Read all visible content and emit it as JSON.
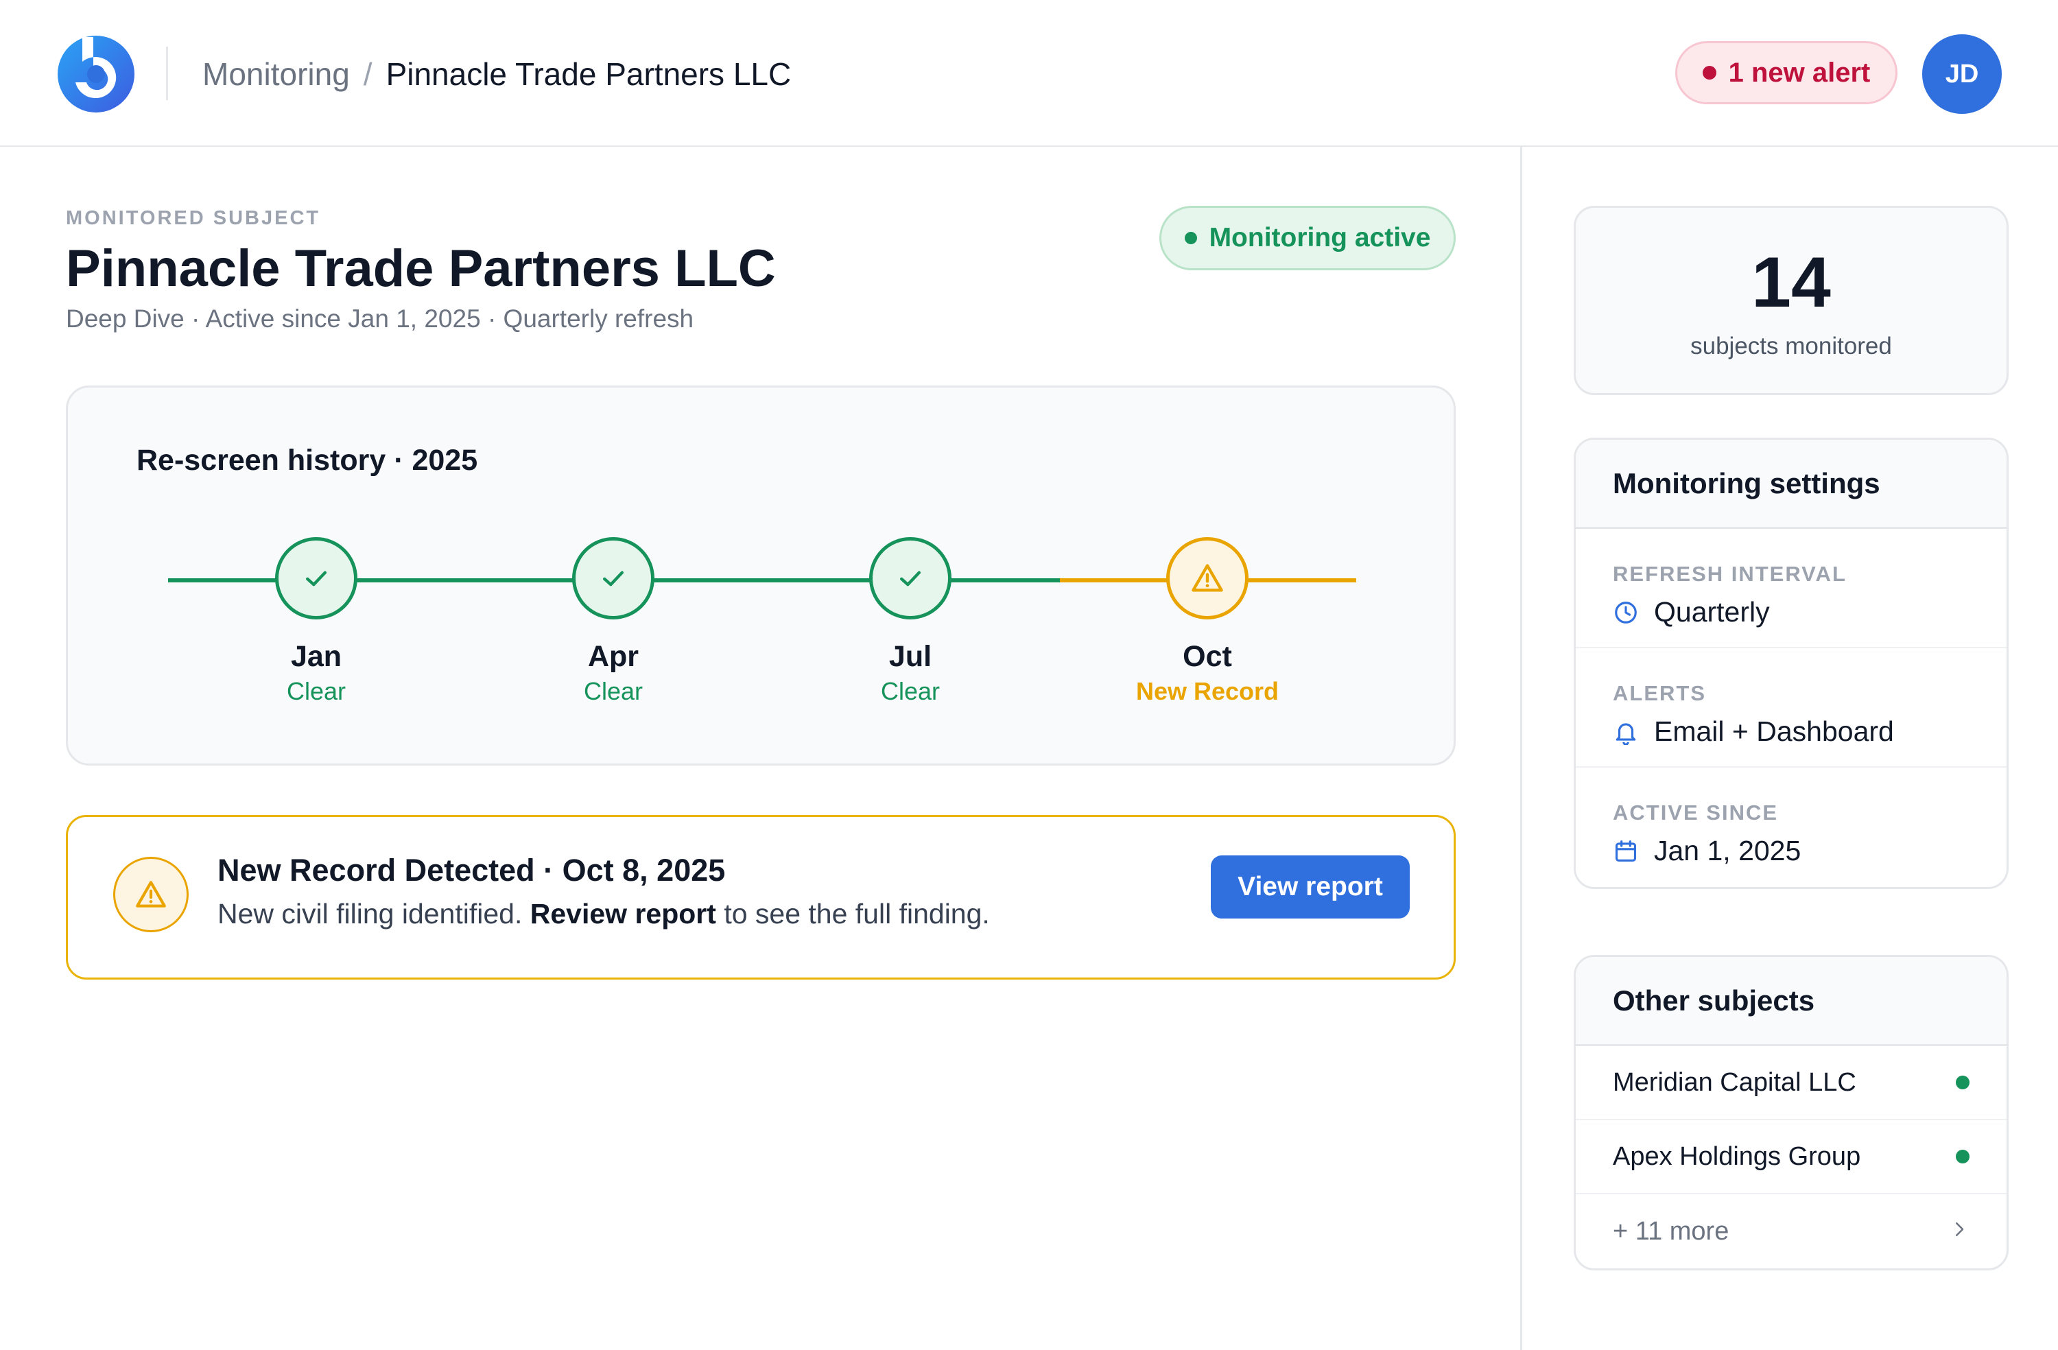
{
  "header": {
    "breadcrumb_root": "Monitoring",
    "breadcrumb_sep": "/",
    "breadcrumb_current": "Pinnacle Trade Partners LLC",
    "alert_label": "1 new alert",
    "avatar_initials": "JD",
    "logo_icon": "brand-logo-icon"
  },
  "subject": {
    "eyebrow": "MONITORED SUBJECT",
    "name": "Pinnacle Trade Partners LLC",
    "meta": "Deep Dive · Active since Jan 1, 2025 · Quarterly refresh",
    "status": "Monitoring active"
  },
  "history": {
    "title": "Re-screen history · 2025",
    "checkpoints": [
      {
        "month": "Jan",
        "status": "Clear",
        "state": "clear",
        "icon": "check-icon"
      },
      {
        "month": "Apr",
        "status": "Clear",
        "state": "clear",
        "icon": "check-icon"
      },
      {
        "month": "Jul",
        "status": "Clear",
        "state": "clear",
        "icon": "check-icon"
      },
      {
        "month": "Oct",
        "status": "New Record",
        "state": "warn",
        "icon": "warning-icon"
      }
    ]
  },
  "record_alert": {
    "title": "New Record Detected · Oct 8, 2025",
    "body_prefix": "New civil filing identified.",
    "body_strong": "Review report",
    "body_suffix": "to see the full finding.",
    "button_label": "View report"
  },
  "stats": {
    "count": "14",
    "label": "subjects monitored"
  },
  "settings": {
    "title": "Monitoring settings",
    "items": [
      {
        "label": "REFRESH INTERVAL",
        "value": "Quarterly",
        "icon": "clock-icon"
      },
      {
        "label": "ALERTS",
        "value": "Email + Dashboard",
        "icon": "bell-icon"
      },
      {
        "label": "ACTIVE SINCE",
        "value": "Jan 1, 2025",
        "icon": "calendar-icon"
      }
    ]
  },
  "others": {
    "title": "Other subjects",
    "items": [
      {
        "name": "Meridian Capital LLC"
      },
      {
        "name": "Apex Holdings Group"
      }
    ],
    "more_label": "+ 11 more"
  },
  "colors": {
    "accent": "#2f6fde",
    "success": "#15935a",
    "warning": "#eaa400",
    "alert": "#be123c"
  }
}
